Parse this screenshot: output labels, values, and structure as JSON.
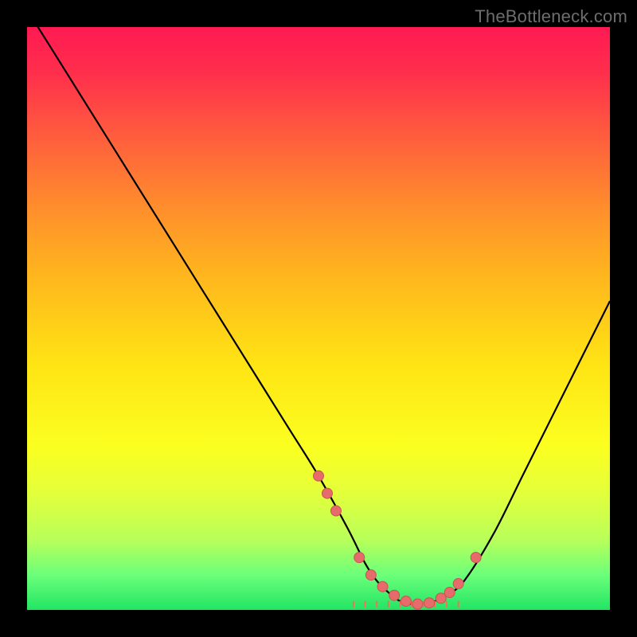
{
  "watermark": "TheBottleneck.com",
  "colors": {
    "curve": "#000000",
    "dot": "#e86b6b",
    "dot_stroke": "#c95353",
    "tick": "#ff6a5a"
  },
  "chart_data": {
    "type": "line",
    "title": "",
    "xlabel": "",
    "ylabel": "",
    "xlim": [
      0,
      100
    ],
    "ylim": [
      0,
      100
    ],
    "series": [
      {
        "name": "bottleneck-curve",
        "x": [
          0,
          5,
          10,
          15,
          20,
          25,
          30,
          35,
          40,
          45,
          50,
          55,
          58,
          60,
          62,
          64,
          66,
          68,
          70,
          72,
          75,
          80,
          85,
          90,
          95,
          100
        ],
        "y": [
          103,
          95,
          87,
          79,
          71,
          63,
          55,
          47,
          39,
          31,
          23,
          14,
          8,
          5,
          3,
          1.5,
          1,
          1,
          1.5,
          2.5,
          5,
          13,
          23,
          33,
          43,
          53
        ]
      }
    ],
    "markers": {
      "name": "highlight-points",
      "x": [
        50,
        51.5,
        53,
        57,
        59,
        61,
        63,
        65,
        67,
        69,
        71,
        72.5,
        74,
        77
      ],
      "y": [
        23,
        20,
        17,
        9,
        6,
        4,
        2.5,
        1.5,
        1,
        1.2,
        2,
        3,
        4.5,
        9
      ]
    },
    "baseline_ticks": {
      "y": 1,
      "x": [
        56,
        58,
        60,
        62,
        64,
        66,
        68,
        70,
        72,
        74
      ]
    }
  }
}
